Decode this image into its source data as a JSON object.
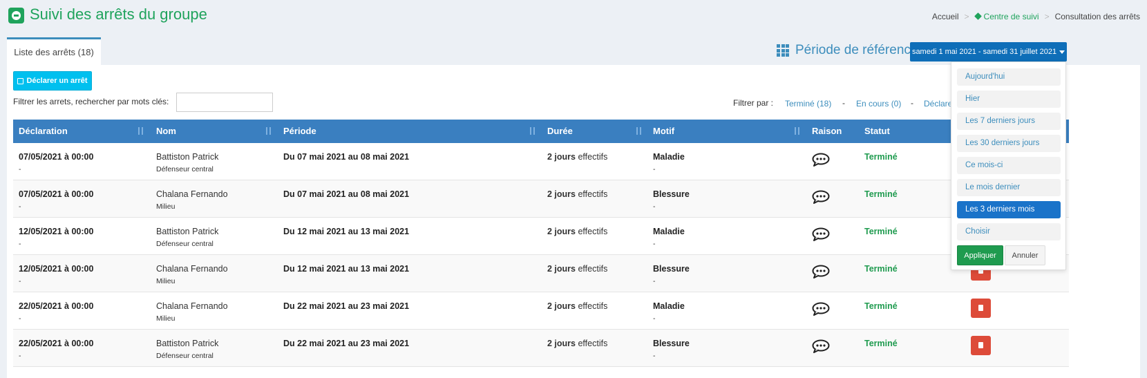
{
  "header": {
    "title": "Suivi des arrêts du groupe",
    "breadcrumb": [
      "Accueil",
      "Centre de suivi",
      "Consultation des arrêts"
    ]
  },
  "tab": {
    "label": "Liste des arrêts (18)"
  },
  "period": {
    "label": "Période de référence",
    "selected": "samedi 1 mai 2021 - samedi 31 juillet 2021"
  },
  "toolbar": {
    "declare_label": "Déclarer un arrêt",
    "search_label": "Filtrer les arrets, rechercher par mots clés:",
    "search_value": "",
    "filter_by": "Filtrer par :",
    "filters": [
      "Terminé (18)",
      "En cours (0)",
      "Déclare"
    ]
  },
  "table": {
    "headers": [
      "Déclaration",
      "Nom",
      "Période",
      "Durée",
      "Motif",
      "Raison",
      "Statut"
    ],
    "duration_suffix": "effectifs",
    "rows": [
      {
        "decl": "07/05/2021 à 00:00",
        "decl_sub": "-",
        "name": "Battiston Patrick",
        "role": "Défenseur central",
        "period": "Du 07 mai 2021 au 08 mai 2021",
        "days": "2 jours",
        "motif": "Maladie",
        "motif_sub": "-",
        "status": "Terminé"
      },
      {
        "decl": "07/05/2021 à 00:00",
        "decl_sub": "-",
        "name": "Chalana Fernando",
        "role": "Milieu",
        "period": "Du 07 mai 2021 au 08 mai 2021",
        "days": "2 jours",
        "motif": "Blessure",
        "motif_sub": "-",
        "status": "Terminé"
      },
      {
        "decl": "12/05/2021 à 00:00",
        "decl_sub": "-",
        "name": "Battiston Patrick",
        "role": "Défenseur central",
        "period": "Du 12 mai 2021 au 13 mai 2021",
        "days": "2 jours",
        "motif": "Maladie",
        "motif_sub": "-",
        "status": "Terminé"
      },
      {
        "decl": "12/05/2021 à 00:00",
        "decl_sub": "-",
        "name": "Chalana Fernando",
        "role": "Milieu",
        "period": "Du 12 mai 2021 au 13 mai 2021",
        "days": "2 jours",
        "motif": "Blessure",
        "motif_sub": "-",
        "status": "Terminé"
      },
      {
        "decl": "22/05/2021 à 00:00",
        "decl_sub": "-",
        "name": "Chalana Fernando",
        "role": "Milieu",
        "period": "Du 22 mai 2021 au 23 mai 2021",
        "days": "2 jours",
        "motif": "Maladie",
        "motif_sub": "-",
        "status": "Terminé"
      },
      {
        "decl": "22/05/2021 à 00:00",
        "decl_sub": "-",
        "name": "Battiston Patrick",
        "role": "Défenseur central",
        "period": "Du 22 mai 2021 au 23 mai 2021",
        "days": "2 jours",
        "motif": "Blessure",
        "motif_sub": "-",
        "status": "Terminé"
      }
    ]
  },
  "ranges": {
    "items": [
      "Aujourd'hui",
      "Hier",
      "Les 7 derniers jours",
      "Les 30 derniers jours",
      "Ce mois-ci",
      "Le mois dernier",
      "Les 3 derniers mois",
      "Choisir"
    ],
    "active_index": 6,
    "apply_label": "Appliquer",
    "cancel_label": "Annuler"
  },
  "colors": {
    "brand_green": "#1fa35c",
    "header_blue": "#3a7fc0",
    "accent_blue": "#0e6eb8",
    "danger_red": "#dd4b39"
  }
}
